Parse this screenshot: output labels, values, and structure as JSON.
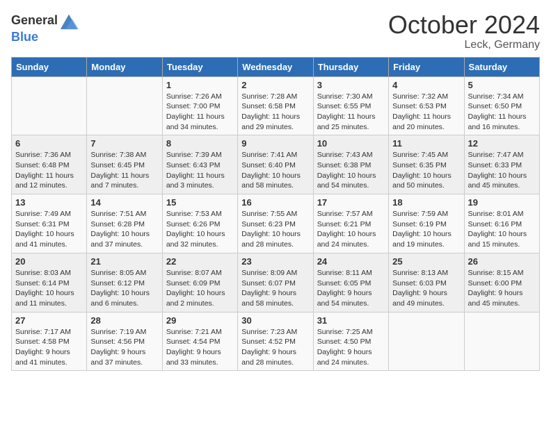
{
  "header": {
    "logo_general": "General",
    "logo_blue": "Blue",
    "month_year": "October 2024",
    "location": "Leck, Germany"
  },
  "days_of_week": [
    "Sunday",
    "Monday",
    "Tuesday",
    "Wednesday",
    "Thursday",
    "Friday",
    "Saturday"
  ],
  "weeks": [
    {
      "days": [
        {
          "num": "",
          "info": ""
        },
        {
          "num": "",
          "info": ""
        },
        {
          "num": "1",
          "info": "Sunrise: 7:26 AM\nSunset: 7:00 PM\nDaylight: 11 hours\nand 34 minutes."
        },
        {
          "num": "2",
          "info": "Sunrise: 7:28 AM\nSunset: 6:58 PM\nDaylight: 11 hours\nand 29 minutes."
        },
        {
          "num": "3",
          "info": "Sunrise: 7:30 AM\nSunset: 6:55 PM\nDaylight: 11 hours\nand 25 minutes."
        },
        {
          "num": "4",
          "info": "Sunrise: 7:32 AM\nSunset: 6:53 PM\nDaylight: 11 hours\nand 20 minutes."
        },
        {
          "num": "5",
          "info": "Sunrise: 7:34 AM\nSunset: 6:50 PM\nDaylight: 11 hours\nand 16 minutes."
        }
      ]
    },
    {
      "days": [
        {
          "num": "6",
          "info": "Sunrise: 7:36 AM\nSunset: 6:48 PM\nDaylight: 11 hours\nand 12 minutes."
        },
        {
          "num": "7",
          "info": "Sunrise: 7:38 AM\nSunset: 6:45 PM\nDaylight: 11 hours\nand 7 minutes."
        },
        {
          "num": "8",
          "info": "Sunrise: 7:39 AM\nSunset: 6:43 PM\nDaylight: 11 hours\nand 3 minutes."
        },
        {
          "num": "9",
          "info": "Sunrise: 7:41 AM\nSunset: 6:40 PM\nDaylight: 10 hours\nand 58 minutes."
        },
        {
          "num": "10",
          "info": "Sunrise: 7:43 AM\nSunset: 6:38 PM\nDaylight: 10 hours\nand 54 minutes."
        },
        {
          "num": "11",
          "info": "Sunrise: 7:45 AM\nSunset: 6:35 PM\nDaylight: 10 hours\nand 50 minutes."
        },
        {
          "num": "12",
          "info": "Sunrise: 7:47 AM\nSunset: 6:33 PM\nDaylight: 10 hours\nand 45 minutes."
        }
      ]
    },
    {
      "days": [
        {
          "num": "13",
          "info": "Sunrise: 7:49 AM\nSunset: 6:31 PM\nDaylight: 10 hours\nand 41 minutes."
        },
        {
          "num": "14",
          "info": "Sunrise: 7:51 AM\nSunset: 6:28 PM\nDaylight: 10 hours\nand 37 minutes."
        },
        {
          "num": "15",
          "info": "Sunrise: 7:53 AM\nSunset: 6:26 PM\nDaylight: 10 hours\nand 32 minutes."
        },
        {
          "num": "16",
          "info": "Sunrise: 7:55 AM\nSunset: 6:23 PM\nDaylight: 10 hours\nand 28 minutes."
        },
        {
          "num": "17",
          "info": "Sunrise: 7:57 AM\nSunset: 6:21 PM\nDaylight: 10 hours\nand 24 minutes."
        },
        {
          "num": "18",
          "info": "Sunrise: 7:59 AM\nSunset: 6:19 PM\nDaylight: 10 hours\nand 19 minutes."
        },
        {
          "num": "19",
          "info": "Sunrise: 8:01 AM\nSunset: 6:16 PM\nDaylight: 10 hours\nand 15 minutes."
        }
      ]
    },
    {
      "days": [
        {
          "num": "20",
          "info": "Sunrise: 8:03 AM\nSunset: 6:14 PM\nDaylight: 10 hours\nand 11 minutes."
        },
        {
          "num": "21",
          "info": "Sunrise: 8:05 AM\nSunset: 6:12 PM\nDaylight: 10 hours\nand 6 minutes."
        },
        {
          "num": "22",
          "info": "Sunrise: 8:07 AM\nSunset: 6:09 PM\nDaylight: 10 hours\nand 2 minutes."
        },
        {
          "num": "23",
          "info": "Sunrise: 8:09 AM\nSunset: 6:07 PM\nDaylight: 9 hours\nand 58 minutes."
        },
        {
          "num": "24",
          "info": "Sunrise: 8:11 AM\nSunset: 6:05 PM\nDaylight: 9 hours\nand 54 minutes."
        },
        {
          "num": "25",
          "info": "Sunrise: 8:13 AM\nSunset: 6:03 PM\nDaylight: 9 hours\nand 49 minutes."
        },
        {
          "num": "26",
          "info": "Sunrise: 8:15 AM\nSunset: 6:00 PM\nDaylight: 9 hours\nand 45 minutes."
        }
      ]
    },
    {
      "days": [
        {
          "num": "27",
          "info": "Sunrise: 7:17 AM\nSunset: 4:58 PM\nDaylight: 9 hours\nand 41 minutes."
        },
        {
          "num": "28",
          "info": "Sunrise: 7:19 AM\nSunset: 4:56 PM\nDaylight: 9 hours\nand 37 minutes."
        },
        {
          "num": "29",
          "info": "Sunrise: 7:21 AM\nSunset: 4:54 PM\nDaylight: 9 hours\nand 33 minutes."
        },
        {
          "num": "30",
          "info": "Sunrise: 7:23 AM\nSunset: 4:52 PM\nDaylight: 9 hours\nand 28 minutes."
        },
        {
          "num": "31",
          "info": "Sunrise: 7:25 AM\nSunset: 4:50 PM\nDaylight: 9 hours\nand 24 minutes."
        },
        {
          "num": "",
          "info": ""
        },
        {
          "num": "",
          "info": ""
        }
      ]
    }
  ]
}
